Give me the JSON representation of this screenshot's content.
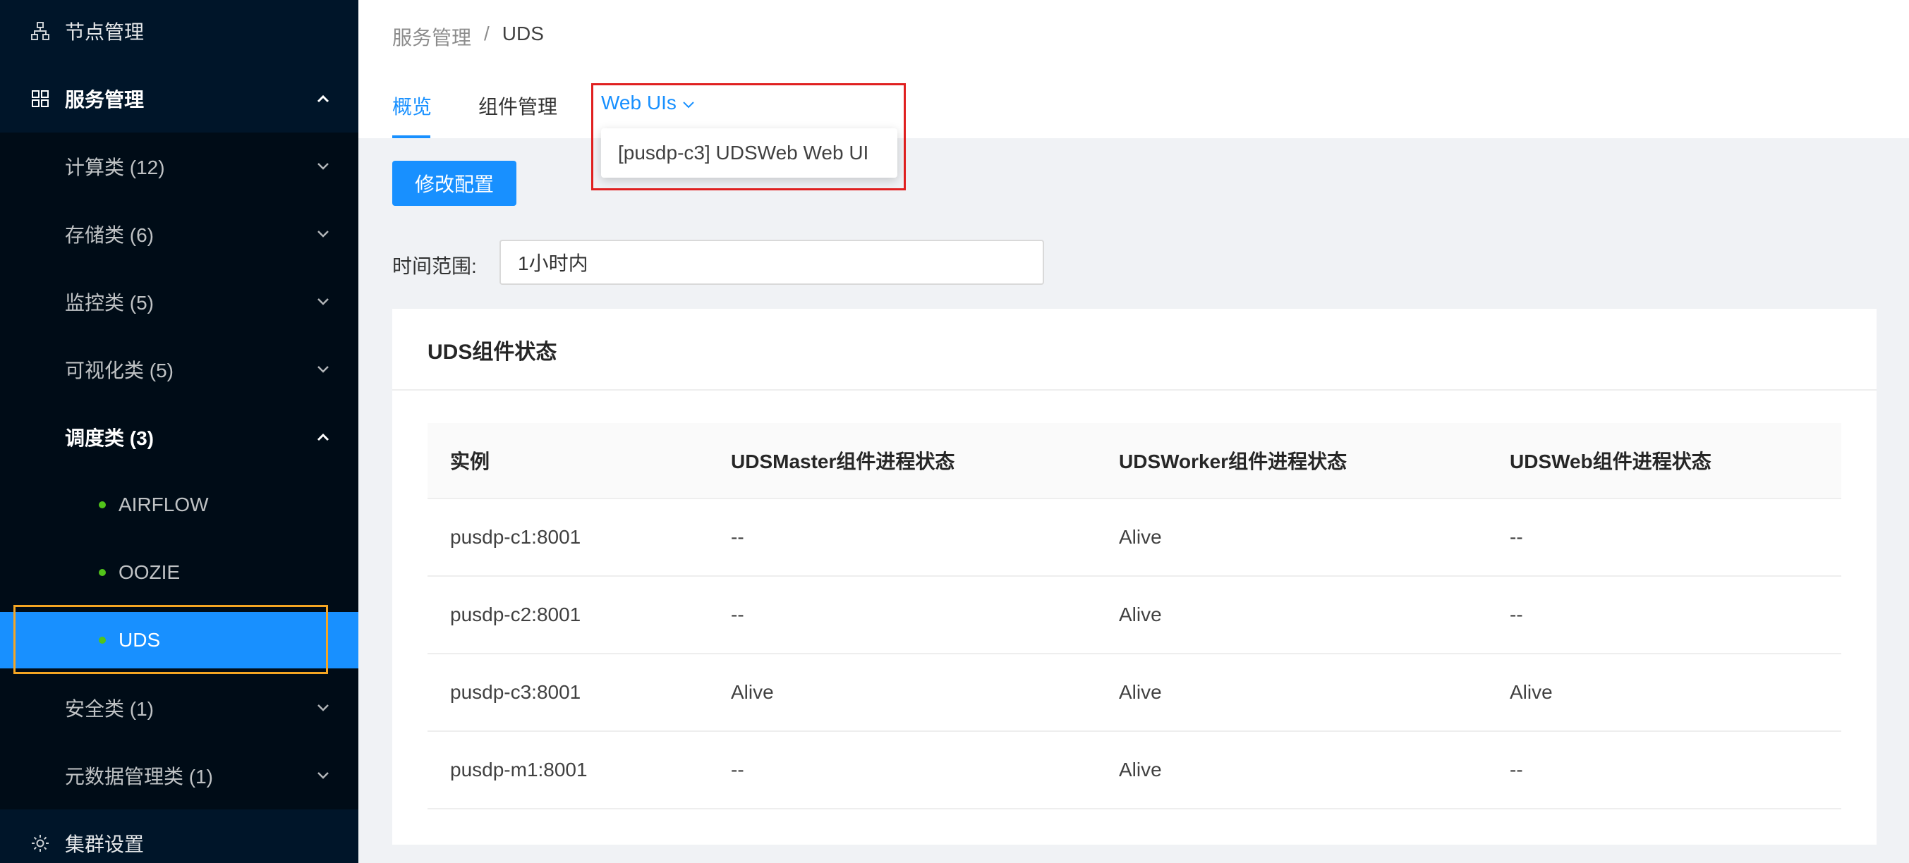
{
  "sidebar": {
    "node_mgmt": "节点管理",
    "service_mgmt": "服务管理",
    "categories": [
      {
        "label": "计算类 (12)"
      },
      {
        "label": "存储类 (6)"
      },
      {
        "label": "监控类 (5)"
      },
      {
        "label": "可视化类 (5)"
      },
      {
        "label": "调度类 (3)"
      },
      {
        "label": "安全类 (1)"
      },
      {
        "label": "元数据管理类 (1)"
      }
    ],
    "scheduler_items": [
      "AIRFLOW",
      "OOZIE",
      "UDS"
    ],
    "cluster_settings": "集群设置"
  },
  "breadcrumb": {
    "parent": "服务管理",
    "sep": "/",
    "current": "UDS"
  },
  "tabs": {
    "overview": "概览",
    "components": "组件管理",
    "webuis": "Web UIs"
  },
  "dropdown": {
    "item": "[pusdp-c3] UDSWeb Web UI"
  },
  "toolbar": {
    "edit_config": "修改配置"
  },
  "time_range": {
    "label": "时间范围:",
    "value": "1小时内"
  },
  "card": {
    "title": "UDS组件状态",
    "columns": [
      "实例",
      "UDSMaster组件进程状态",
      "UDSWorker组件进程状态",
      "UDSWeb组件进程状态"
    ],
    "rows": [
      [
        "pusdp-c1:8001",
        "--",
        "Alive",
        "--"
      ],
      [
        "pusdp-c2:8001",
        "--",
        "Alive",
        "--"
      ],
      [
        "pusdp-c3:8001",
        "Alive",
        "Alive",
        "Alive"
      ],
      [
        "pusdp-m1:8001",
        "--",
        "Alive",
        "--"
      ]
    ]
  },
  "colors": {
    "primary": "#1890ff",
    "sidebar": "#001529",
    "status_dot": "#52c41a",
    "highlight_red": "#e02020",
    "highlight_orange": "#f5a623"
  }
}
